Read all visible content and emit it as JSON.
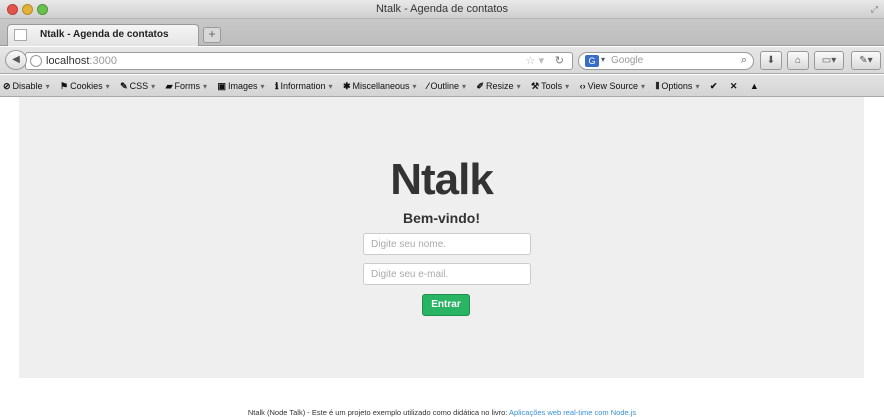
{
  "window": {
    "title": "Ntalk - Agenda de contatos"
  },
  "tabs": [
    {
      "label": "Ntalk - Agenda de contatos"
    }
  ],
  "navbar": {
    "url_host": "localhost",
    "url_port": ":3000",
    "search_engine": "Google",
    "search_placeholder": "Google"
  },
  "devtoolbar": {
    "items": [
      {
        "label": "Disable",
        "icon": "disable-icon"
      },
      {
        "label": "Cookies",
        "icon": "cookies-icon"
      },
      {
        "label": "CSS",
        "icon": "css-icon"
      },
      {
        "label": "Forms",
        "icon": "forms-icon"
      },
      {
        "label": "Images",
        "icon": "images-icon"
      },
      {
        "label": "Information",
        "icon": "information-icon"
      },
      {
        "label": "Miscellaneous",
        "icon": "miscellaneous-icon"
      },
      {
        "label": "Outline",
        "icon": "outline-icon"
      },
      {
        "label": "Resize",
        "icon": "resize-icon"
      },
      {
        "label": "Tools",
        "icon": "tools-icon"
      },
      {
        "label": "View Source",
        "icon": "view-source-icon"
      },
      {
        "label": "Options",
        "icon": "options-icon"
      }
    ]
  },
  "page": {
    "brand": "Ntalk",
    "welcome": "Bem-vindo!",
    "name_placeholder": "Digite seu nome.",
    "email_placeholder": "Digite seu e-mail.",
    "submit_label": "Entrar",
    "footer_text": "Ntalk (Node Talk) - Este é um projeto exemplo utilizado como didática no livro: ",
    "footer_link": "Aplicações web real-time com Node.js"
  },
  "colors": {
    "submit_button": "#28b463",
    "hero_background": "#efefef",
    "footer_link": "#3a8fd6"
  }
}
